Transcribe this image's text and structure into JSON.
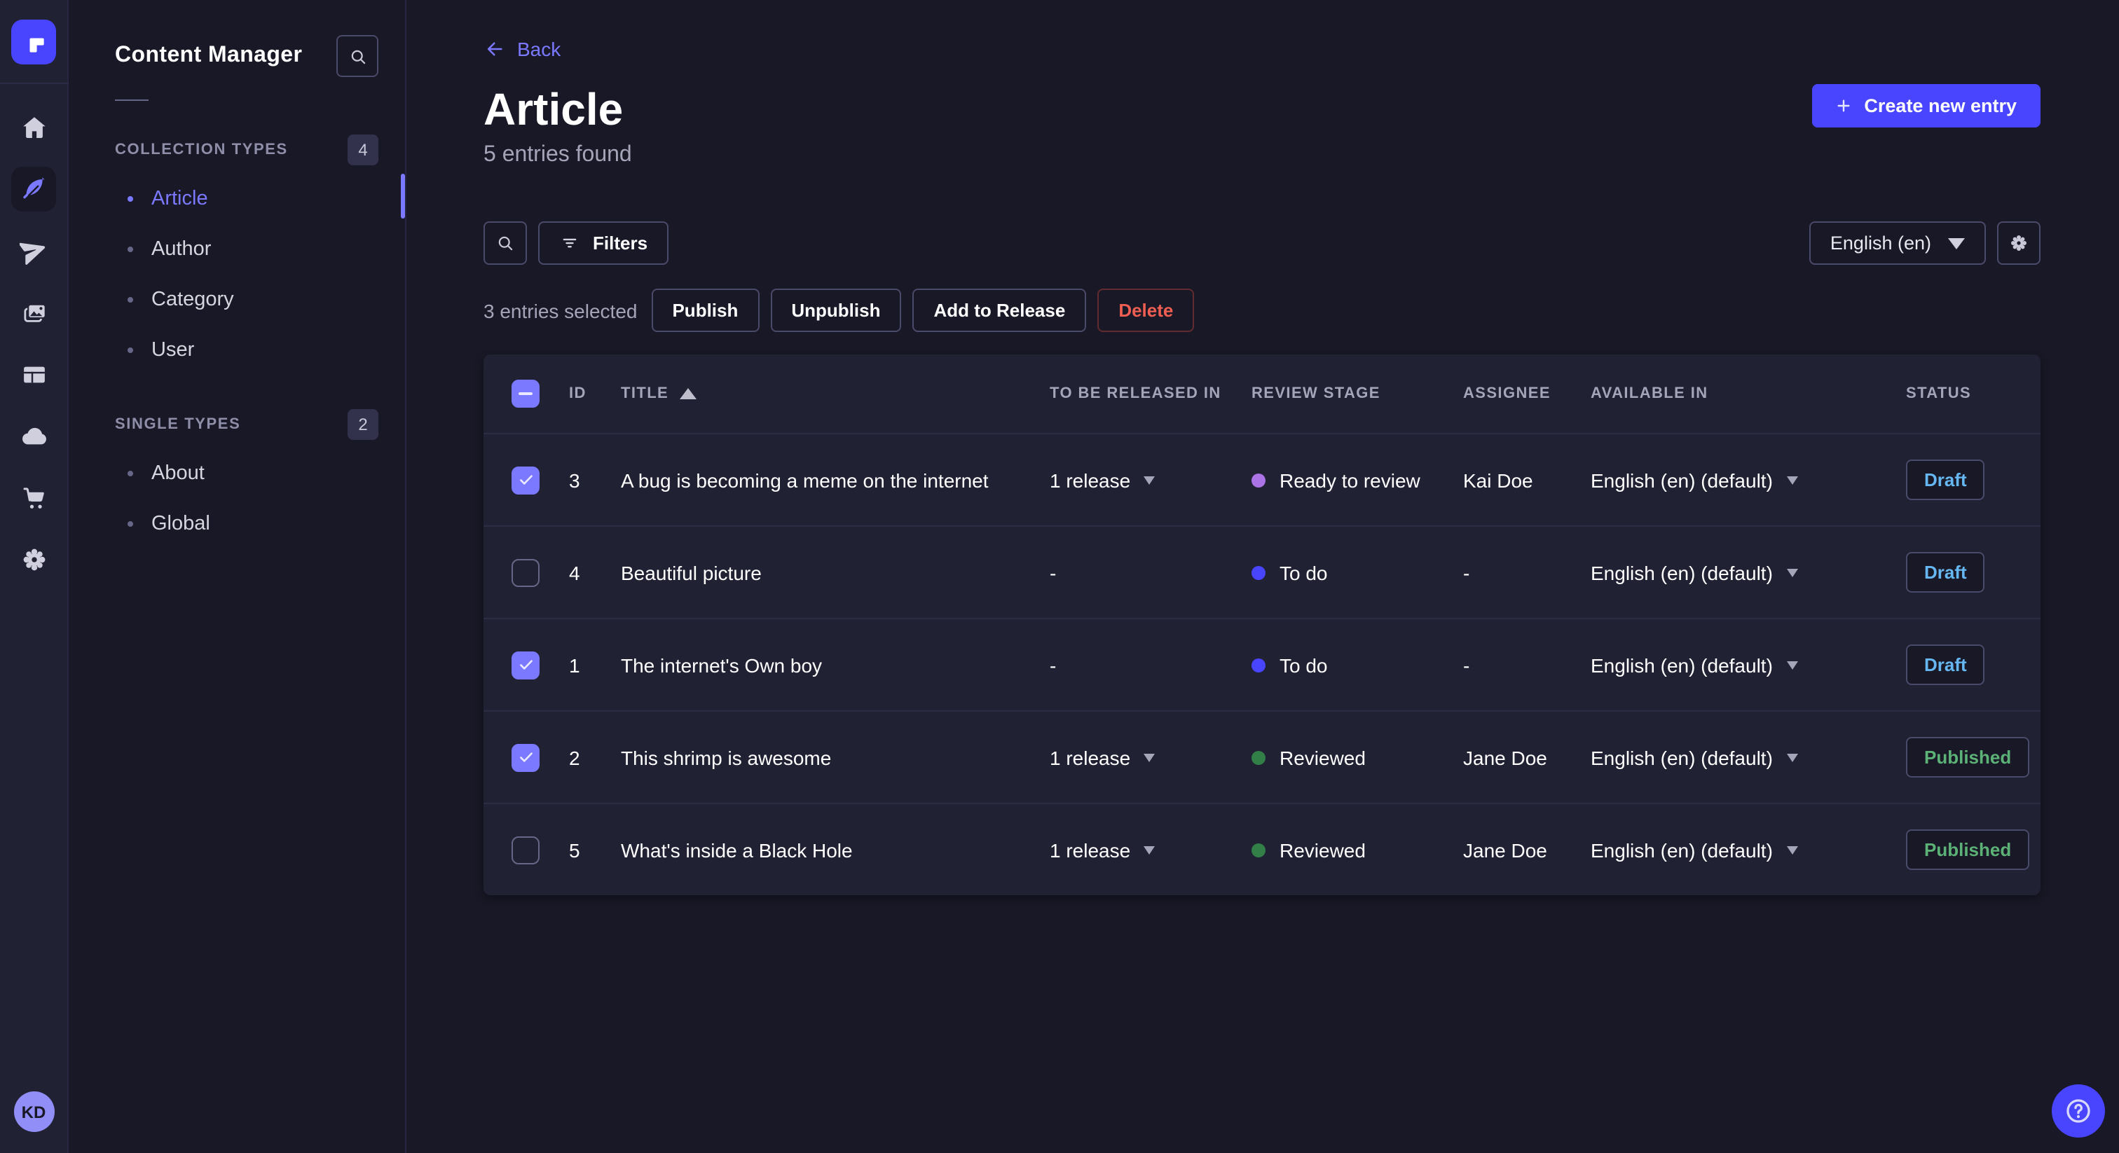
{
  "colors": {
    "accent": "#4945ff",
    "accent_light": "#7b79ff",
    "page_bg": "#181826",
    "panel_bg": "#212134",
    "draft_text": "#66b7f1",
    "published_text": "#5cb176",
    "danger_text": "#ee5e52",
    "stage_todo": "#4945ff",
    "stage_ready_to_review": "#ac73e6",
    "stage_reviewed": "#328048"
  },
  "left_nav": {
    "icons": [
      "strapi-logo",
      "home-icon",
      "content-manager-feather-icon",
      "releases-paper-plane-icon",
      "media-library-images-icon",
      "content-type-builder-layout-icon",
      "deploy-cloud-icon",
      "marketplace-cart-icon",
      "settings-gear-icon"
    ],
    "avatar_initials": "KD"
  },
  "sidebar": {
    "title": "Content Manager",
    "sections": [
      {
        "label": "COLLECTION TYPES",
        "count": "4",
        "items": [
          {
            "label": "Article",
            "active": true
          },
          {
            "label": "Author",
            "active": false
          },
          {
            "label": "Category",
            "active": false
          },
          {
            "label": "User",
            "active": false
          }
        ]
      },
      {
        "label": "SINGLE TYPES",
        "count": "2",
        "items": [
          {
            "label": "About",
            "active": false
          },
          {
            "label": "Global",
            "active": false
          }
        ]
      }
    ]
  },
  "header": {
    "back_label": "Back",
    "title": "Article",
    "subtitle": "5 entries found",
    "create_button_label": "Create new entry"
  },
  "toolbar": {
    "filters_label": "Filters",
    "locale_value": "English (en)"
  },
  "selection": {
    "label": "3 entries selected",
    "publish_label": "Publish",
    "unpublish_label": "Unpublish",
    "add_to_release_label": "Add to Release",
    "delete_label": "Delete"
  },
  "table": {
    "columns": {
      "id": "ID",
      "title": "TITLE",
      "release": "TO BE RELEASED IN",
      "stage": "REVIEW STAGE",
      "assignee": "ASSIGNEE",
      "available": "AVAILABLE IN",
      "status": "STATUS"
    },
    "rows": [
      {
        "checked": true,
        "id": "3",
        "title": "A bug is becoming a meme on the internet",
        "release": "1 release",
        "release_menu": true,
        "stage": "Ready to review",
        "stage_color": "#ac73e6",
        "assignee": "Kai Doe",
        "locale": "English (en) (default)",
        "status": "Draft",
        "status_color": "#66b7f1"
      },
      {
        "checked": false,
        "id": "4",
        "title": "Beautiful picture",
        "release": "-",
        "release_menu": false,
        "stage": "To do",
        "stage_color": "#4945ff",
        "assignee": "-",
        "locale": "English (en) (default)",
        "status": "Draft",
        "status_color": "#66b7f1"
      },
      {
        "checked": true,
        "id": "1",
        "title": "The internet's Own boy",
        "release": "-",
        "release_menu": false,
        "stage": "To do",
        "stage_color": "#4945ff",
        "assignee": "-",
        "locale": "English (en) (default)",
        "status": "Draft",
        "status_color": "#66b7f1"
      },
      {
        "checked": true,
        "id": "2",
        "title": "This shrimp is awesome",
        "release": "1 release",
        "release_menu": true,
        "stage": "Reviewed",
        "stage_color": "#328048",
        "assignee": "Jane Doe",
        "locale": "English (en) (default)",
        "status": "Published",
        "status_color": "#5cb176"
      },
      {
        "checked": false,
        "id": "5",
        "title": "What's inside a Black Hole",
        "release": "1 release",
        "release_menu": true,
        "stage": "Reviewed",
        "stage_color": "#328048",
        "assignee": "Jane Doe",
        "locale": "English (en) (default)",
        "status": "Published",
        "status_color": "#5cb176"
      }
    ]
  }
}
